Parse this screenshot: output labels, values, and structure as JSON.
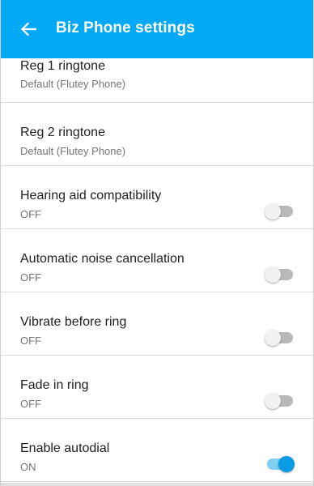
{
  "app_bar": {
    "title": "Biz Phone settings",
    "back_icon": "arrow-left-icon",
    "background_color": "#03a9f4"
  },
  "settings": [
    {
      "title": "Reg 1 ringtone",
      "summary": "Default (Flutey Phone)",
      "toggle": null
    },
    {
      "title": "Reg 2 ringtone",
      "summary": "Default (Flutey Phone)",
      "toggle": null
    },
    {
      "title": "Hearing aid compatibility",
      "summary": "OFF",
      "toggle": false
    },
    {
      "title": "Automatic noise cancellation",
      "summary": "OFF",
      "toggle": false
    },
    {
      "title": "Vibrate before ring",
      "summary": "OFF",
      "toggle": false
    },
    {
      "title": "Fade in ring",
      "summary": "OFF",
      "toggle": false
    },
    {
      "title": "Enable autodial",
      "summary": "ON",
      "toggle": true
    }
  ],
  "colors": {
    "switch_on_thumb": "#0a9be2",
    "switch_on_track": "#7fcef5",
    "switch_off_track": "#b9b9b9"
  }
}
